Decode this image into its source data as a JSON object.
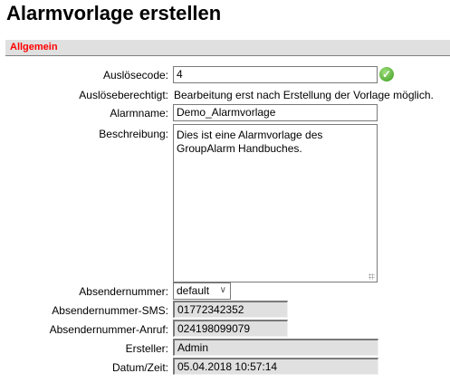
{
  "page_title": "Alarmvorlage erstellen",
  "section": "Allgemein",
  "fields": {
    "code": {
      "label": "Auslösecode:",
      "value": "4",
      "status_icon": "check-circle-icon"
    },
    "berechtigt": {
      "label": "Auslöseberechtigt:",
      "value": "Bearbeitung erst nach Erstellung der Vorlage möglich."
    },
    "name": {
      "label": "Alarmname:",
      "value": "Demo_Alarmvorlage"
    },
    "beschreibung": {
      "label": "Beschreibung:",
      "value": "Dies ist eine Alarmvorlage des GroupAlarm Handbuches."
    },
    "absender": {
      "label": "Absendernummer:",
      "value": "default"
    },
    "sms": {
      "label": "Absendernummer-SMS:",
      "value": "01772342352"
    },
    "anruf": {
      "label": "Absendernummer-Anruf:",
      "value": "024198099079"
    },
    "ersteller": {
      "label": "Ersteller:",
      "value": "Admin"
    },
    "datum": {
      "label": "Datum/Zeit:",
      "value": "05.04.2018 10:57:14"
    }
  }
}
